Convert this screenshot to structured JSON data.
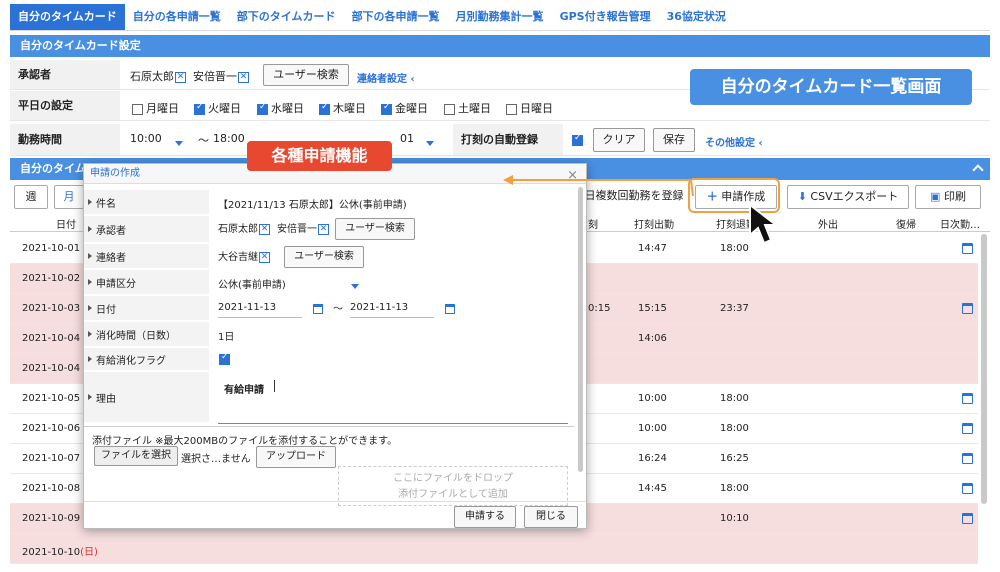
{
  "nav": {
    "tabs": [
      {
        "label": "自分のタイムカード"
      },
      {
        "label": "自分の各申請一覧"
      },
      {
        "label": "部下のタイムカード"
      },
      {
        "label": "部下の各申請一覧"
      },
      {
        "label": "月別勤務集計一覧"
      },
      {
        "label": "GPS付き報告管理"
      },
      {
        "label": "36協定状況"
      }
    ]
  },
  "settings": {
    "title": "自分のタイムカード設定",
    "approver_label": "承認者",
    "approvers": [
      "石原太郎",
      "安倍晋一"
    ],
    "user_search_label": "ユーザー検索",
    "contact_link": "連絡者設定",
    "weekday_label": "平日の設定",
    "days": [
      {
        "label": "月曜日",
        "checked": false
      },
      {
        "label": "火曜日",
        "checked": true
      },
      {
        "label": "水曜日",
        "checked": true
      },
      {
        "label": "木曜日",
        "checked": true
      },
      {
        "label": "金曜日",
        "checked": true
      },
      {
        "label": "土曜日",
        "checked": false
      },
      {
        "label": "日曜日",
        "checked": false
      }
    ],
    "worktime_label": "勤務時間",
    "start_time": "10:00",
    "tilde": "～",
    "end_time": "18:00",
    "other_value": "01",
    "auto_stamp_label": "打刻の自動登録",
    "clear_label": "クリア",
    "save_label": "保存",
    "other_settings_link": "その他設定",
    "screen_callout": "自分のタイムカード一覧画面"
  },
  "list": {
    "title": "自分のタイム",
    "week_label": "週",
    "month_label": "月",
    "multi_register_label": "日複数回勤務を登録",
    "create_request_label": "申請作成",
    "csv_export_label": "CSVエクスポート",
    "print_label": "印刷",
    "headers": {
      "date": "日付",
      "partial": "刻",
      "clock_in": "打刻出勤",
      "clock_out": "打刻退勤",
      "out": "外出",
      "return": "復帰",
      "daily": "日次勤…"
    },
    "rows": [
      {
        "date": "2021-10-01",
        "pink": false,
        "partial": "",
        "clock_in": "14:47",
        "clock_out": "18:00",
        "icon": true
      },
      {
        "date": "2021-10-02",
        "pink": true,
        "partial": "",
        "clock_in": "",
        "clock_out": "",
        "icon": false
      },
      {
        "date": "2021-10-03",
        "pink": true,
        "partial": "0:15",
        "clock_in": "15:15",
        "clock_out": "23:37",
        "icon": true
      },
      {
        "date": "2021-10-04",
        "pink": true,
        "partial": "",
        "clock_in": "14:06",
        "clock_out": "",
        "icon": false
      },
      {
        "date": "2021-10-04",
        "pink": true,
        "partial": "",
        "clock_in": "",
        "clock_out": "",
        "icon": false
      },
      {
        "date": "2021-10-05",
        "pink": false,
        "partial": "",
        "clock_in": "10:00",
        "clock_out": "18:00",
        "icon": true
      },
      {
        "date": "2021-10-06",
        "pink": false,
        "partial": "",
        "clock_in": "10:00",
        "clock_out": "18:00",
        "icon": true
      },
      {
        "date": "2021-10-07",
        "pink": false,
        "partial": "",
        "clock_in": "16:24",
        "clock_out": "16:25",
        "icon": true
      },
      {
        "date": "2021-10-08",
        "pink": false,
        "partial": "",
        "clock_in": "14:45",
        "clock_out": "18:00",
        "icon": true
      },
      {
        "date": "2021-10-09",
        "pink": true,
        "partial": "",
        "clock_in": "",
        "clock_out": "10:10",
        "icon": true
      },
      {
        "date": "2021-10-10",
        "pink": true,
        "partial": "",
        "clock_in": "",
        "clock_out": "",
        "icon": false,
        "sun": "(日)"
      }
    ]
  },
  "dialog": {
    "title": "申請の作成",
    "close_glyph": "×",
    "subject_label": "件名",
    "subject_value": "【2021/11/13 石原太郎】公休(事前申請)",
    "approver_label": "承認者",
    "approvers": [
      "石原太郎",
      "安倍晋一"
    ],
    "contact_label": "連絡者",
    "contacts": [
      "大谷吉継"
    ],
    "user_search_label": "ユーザー検索",
    "type_label": "申請区分",
    "type_value": "公休(事前申請)",
    "date_label": "日付",
    "date_from": "2021-11-13",
    "tilde": "～",
    "date_to": "2021-11-13",
    "consume_label": "消化時間（日数）",
    "consume_value": "1日",
    "paid_flag_label": "有給消化フラグ",
    "paid_flag_checked": true,
    "reason_label": "理由",
    "reason_value": "有給申請",
    "attach_note": "添付ファイル ※最大200MBのファイルを添付することができます。",
    "choose_file_label": "ファイルを選択",
    "no_file_label": "選択さ…ません",
    "upload_label": "アップロード",
    "drop_line1": "ここにファイルをドロップ",
    "drop_line2": "添付ファイルとして追加",
    "submit_label": "申請する",
    "close_label": "閉じる"
  },
  "callouts": {
    "feature": "各種申請機能"
  }
}
